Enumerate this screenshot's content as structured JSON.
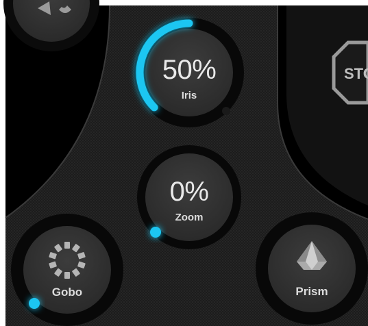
{
  "stop_button": {
    "label": "STOP"
  },
  "iris": {
    "value_text": "50%",
    "label": "Iris",
    "level": 0.5
  },
  "zoom": {
    "value_text": "0%",
    "label": "Zoom",
    "level": 0.0
  },
  "gobo": {
    "label": "Gobo",
    "level": 0.0
  },
  "prism": {
    "label": "Prism",
    "level": 0.0
  },
  "colors": {
    "accent": "#1ec6f2",
    "panel": "#1f1f1f",
    "knob": "#333333",
    "track": "#0a0a0a"
  },
  "icons": {
    "top_left": "color-wheel-icon",
    "gobo": "gobo-icon",
    "prism": "prism-icon"
  }
}
